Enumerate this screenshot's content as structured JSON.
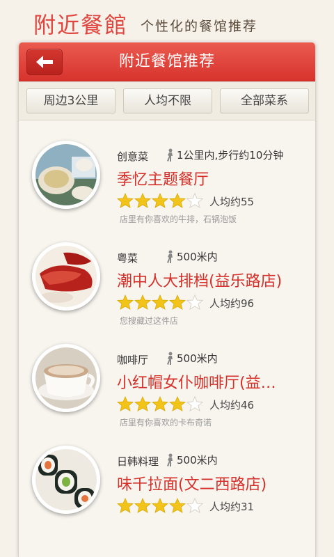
{
  "banner": {
    "title": "附近餐館",
    "subtitle": "个性化的餐馆推荐"
  },
  "header": {
    "title": "附近餐馆推荐",
    "back_icon": "arrow-left-icon"
  },
  "filters": [
    {
      "label": "周边3公里"
    },
    {
      "label": "人均不限"
    },
    {
      "label": "全部菜系"
    }
  ],
  "restaurants": [
    {
      "category": "创意菜",
      "distance": "1公里内,步行约10分钟",
      "name": "季忆主题餐厅",
      "rating": 4,
      "price": "人均约55",
      "note": "店里有你喜欢的牛排，石锅泡饭",
      "thumb": "sushi-plate"
    },
    {
      "category": "粤菜",
      "distance": "500米内",
      "name": "潮中人大排档(益乐路店)",
      "rating": 4,
      "price": "人均约96",
      "note": "您搜藏过这件店",
      "thumb": "roast-meat"
    },
    {
      "category": "咖啡厅",
      "distance": "500米内",
      "name": "小红帽女仆咖啡厅(益…",
      "rating": 4,
      "price": "人均约46",
      "note": "店里有你喜欢的卡布奇诺",
      "thumb": "coffee-cup"
    },
    {
      "category": "日韩料理",
      "distance": "500米内",
      "name": "味千拉面(文二西路店)",
      "rating": 4,
      "price": "人均约31",
      "note": "",
      "thumb": "sushi-roll"
    }
  ],
  "colors": {
    "accent": "#d5302a",
    "star": "#f2c419",
    "background": "#f8f5ef"
  }
}
